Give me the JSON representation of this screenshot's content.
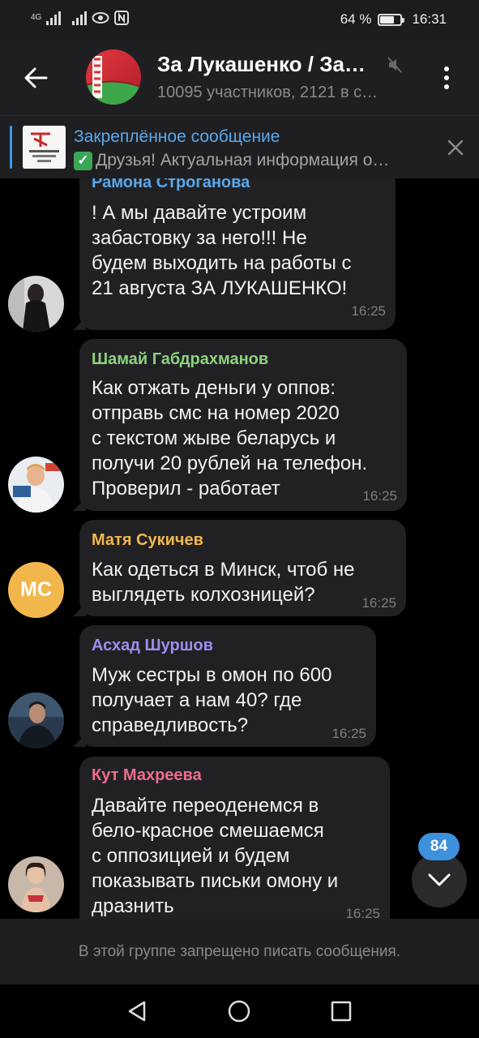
{
  "status_bar": {
    "network_1": "4G",
    "battery_percent": "64 %",
    "battery_level": 0.64,
    "time": "16:31"
  },
  "header": {
    "title": "За Лукашенко / За…",
    "subtitle": "10095 участников, 2121 в с…"
  },
  "pinned": {
    "title": "Закреплённое сообщение",
    "text": "Друзья! Актуальная информация о…",
    "thumb_text": "#Янедоверяю народ"
  },
  "messages": [
    {
      "sender": "Рамона Строганова",
      "sender_color": "#5aa9ec",
      "text": "! А мы давайте устроим\nзабастовку за него!!! Не\nбудем выходить на работы с\n21 августа ЗА ЛУКАШЕНКО!",
      "time": "16:25"
    },
    {
      "sender": "Шамай Габдрахманов",
      "sender_color": "#8ed27e",
      "text": "Как отжать деньги у оппов:\nотправь смс на номер 2020\nс текстом жыве беларусь и\nполучи 20 рублей на телефон.\nПроверил - работает",
      "time": "16:25"
    },
    {
      "sender": "Матя Сукичев",
      "sender_color": "#f2b74c",
      "avatar_initials": "МС",
      "text": "Как  одеться в Минск, чтоб не\nвыглядеть колхозницей?",
      "time": "16:25"
    },
    {
      "sender": "Асхад Шуршов",
      "sender_color": "#9c8ff0",
      "text": "Муж сестры в омон по 600\nполучает а нам 40? где\nсправедливость?",
      "time": "16:25"
    },
    {
      "sender": "Кут Махреева",
      "sender_color": "#ef6d8b",
      "text": "Давайте переоденемся в\nбело-красное смешаемся\nс оппозицией и будем\nпоказывать письки омону и\nдразнить",
      "time": "16:25"
    }
  ],
  "scroll_badge": "84",
  "footer_notice": "В этой группе запрещено писать сообщения.",
  "colors": {
    "accent": "#3d90dc",
    "bubble": "#212123",
    "header": "#1f1f22"
  }
}
